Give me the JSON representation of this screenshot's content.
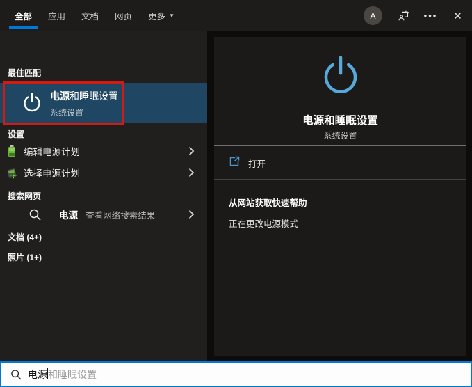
{
  "colors": {
    "accent": "#0078d7",
    "selected_row_bg": "#1f4662",
    "annotation_red": "#d51a12",
    "hero_power_blue": "#57a8db",
    "battery_green": "#6db43c",
    "panel_dark": "#201f1e",
    "card_dark": "#1b1a19"
  },
  "topbar": {
    "tabs": [
      {
        "label": "全部",
        "selected": true
      },
      {
        "label": "应用",
        "selected": false
      },
      {
        "label": "文档",
        "selected": false
      },
      {
        "label": "网页",
        "selected": false
      },
      {
        "label": "更多",
        "selected": false,
        "dropdown": "▼"
      }
    ],
    "avatar_letter": "A",
    "more_dots": "•••",
    "close_glyph": "✕"
  },
  "left": {
    "best_match_header": "最佳匹配",
    "best_match": {
      "title_match": "电源",
      "title_rest": "和睡眠设置",
      "subtitle": "系统设置"
    },
    "settings_header": "设置",
    "settings_items": [
      {
        "label": "编辑电源计划"
      },
      {
        "label": "选择电源计划"
      }
    ],
    "web_header": "搜索网页",
    "web_row": {
      "match": "电源",
      "rest": " - 查看网络搜索结果"
    },
    "docs_header": "文档 (4+)",
    "photos_header": "照片 (1+)"
  },
  "right": {
    "title": "电源和睡眠设置",
    "subtitle": "系统设置",
    "open_label": "打开",
    "help_header": "从网站获取快速帮助",
    "help_item": "正在更改电源模式"
  },
  "search": {
    "typed": "电源",
    "suggestion": "和睡眠设置"
  }
}
